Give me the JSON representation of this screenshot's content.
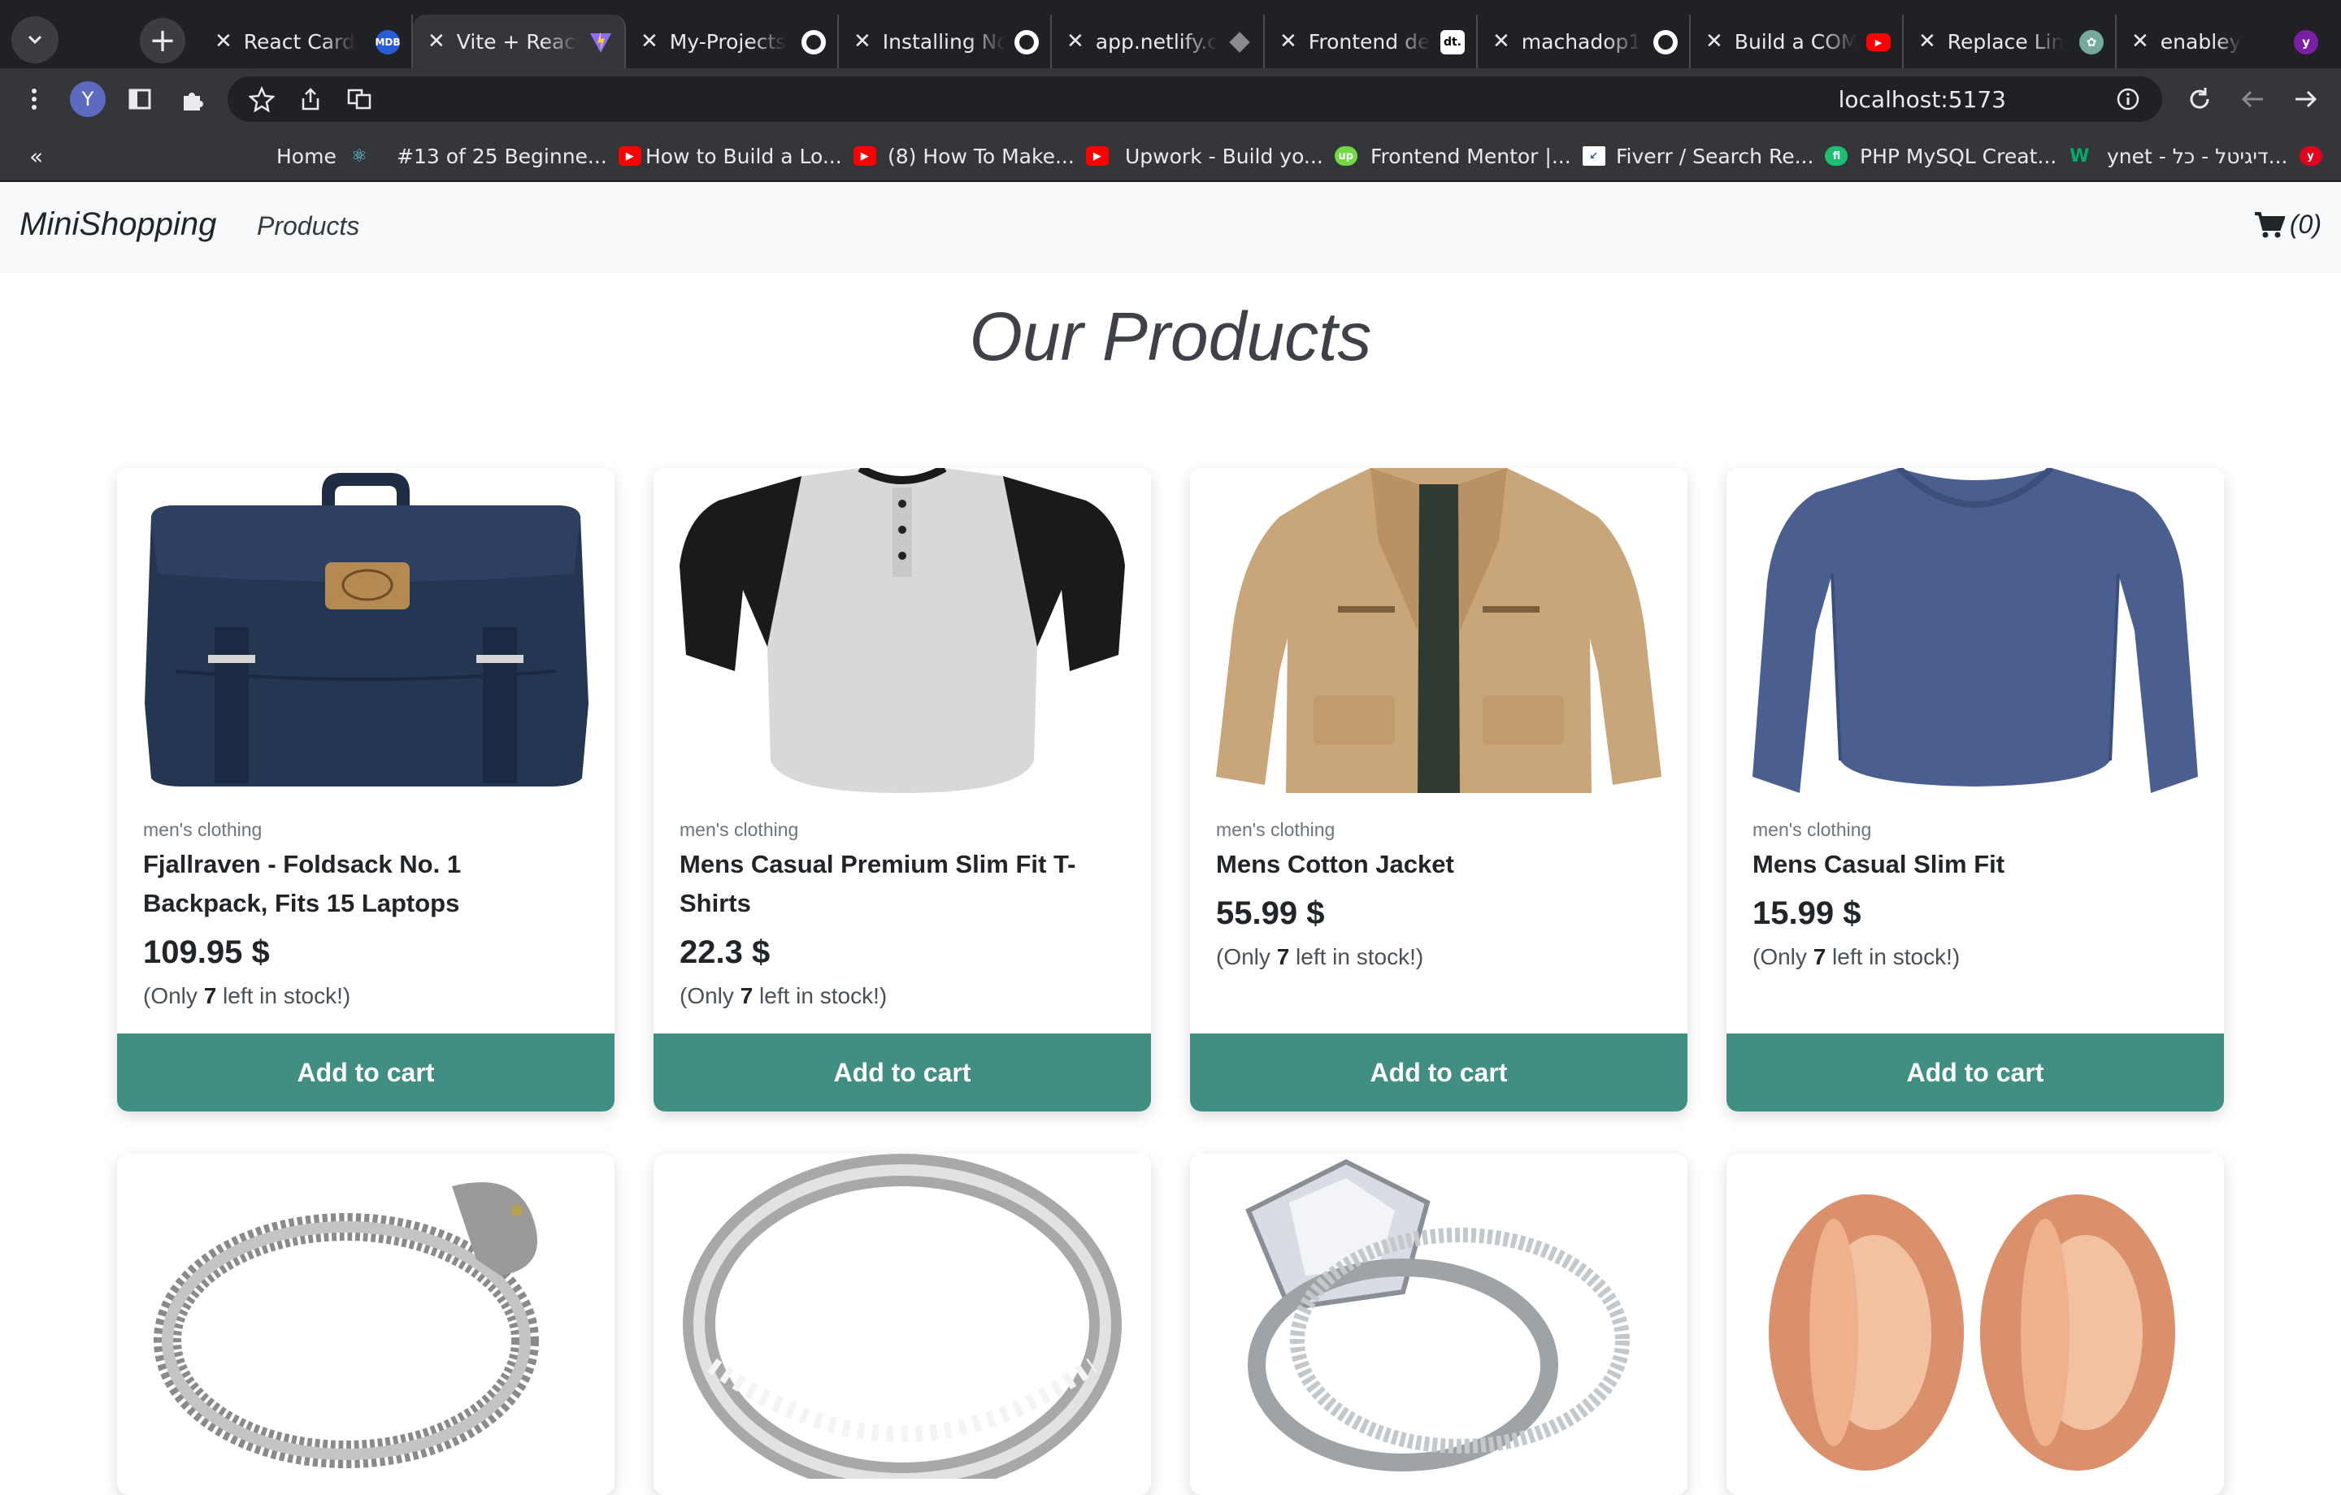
{
  "browser": {
    "tabs": [
      {
        "label": "React Card",
        "favicon": "mdb-icon",
        "active": false
      },
      {
        "label": "Vite + React",
        "favicon": "vite-icon",
        "active": true
      },
      {
        "label": "My-Projects",
        "favicon": "github-icon",
        "active": false
      },
      {
        "label": "Installing Node",
        "favicon": "github-icon",
        "active": false
      },
      {
        "label": "app.netlify.com",
        "favicon": "netlify-icon",
        "active": false
      },
      {
        "label": "Frontend dev",
        "favicon": "dt-icon",
        "active": false
      },
      {
        "label": "machadop1",
        "favicon": "github-icon",
        "active": false
      },
      {
        "label": "Build a COM",
        "favicon": "youtube-icon",
        "active": false
      },
      {
        "label": "Replace Lin",
        "favicon": "chatgpt-icon",
        "active": false
      },
      {
        "label": "enabley",
        "favicon": "yahoo-icon",
        "active": false
      }
    ],
    "new_tab": "+",
    "url": "localhost:5173",
    "profile_initial": "Y",
    "bookmarks_toggle": "«",
    "bookmarks": [
      {
        "label": "Home",
        "icon": "react-icon",
        "color": "#61dafb"
      },
      {
        "label": "#13 of 25 Beginne...",
        "icon": "youtube-icon",
        "color": "#ff0000"
      },
      {
        "label": "How to Build a Lo...",
        "icon": "youtube-icon",
        "color": "#ff0000"
      },
      {
        "label": "(8) How To Make...",
        "icon": "youtube-icon",
        "color": "#ff0000"
      },
      {
        "label": "Upwork - Build yo...",
        "icon": "upwork-icon",
        "color": "#6fda44"
      },
      {
        "label": "Frontend Mentor |...",
        "icon": "frontend-mentor-icon",
        "color": "#ffffff"
      },
      {
        "label": "Fiverr / Search Re...",
        "icon": "fiverr-icon",
        "color": "#1dbf73"
      },
      {
        "label": "PHP MySQL Creat...",
        "icon": "w-icon",
        "color": "#04aa6d"
      },
      {
        "label": "ynet - דיגיטל - כל...",
        "icon": "ynet-icon",
        "color": "#e2001a"
      }
    ]
  },
  "nav": {
    "brand": "MiniShopping",
    "link": "Products",
    "cart_count": "(0)"
  },
  "page": {
    "title": "Our Products"
  },
  "products": [
    {
      "category": "men's clothing",
      "title": "Fjallraven - Foldsack No. 1 Backpack, Fits 15 Laptops",
      "price": "109.95 $",
      "stock_prefix": "(Only ",
      "stock_count": "7",
      "stock_suffix": " left in stock!)",
      "button": "Add to cart",
      "image": "backpack-image"
    },
    {
      "category": "men's clothing",
      "title": "Mens Casual Premium Slim Fit T-Shirts",
      "price": "22.3 $",
      "stock_prefix": "(Only ",
      "stock_count": "7",
      "stock_suffix": " left in stock!)",
      "button": "Add to cart",
      "image": "tshirt-image"
    },
    {
      "category": "men's clothing",
      "title": "Mens Cotton Jacket",
      "price": "55.99 $",
      "stock_prefix": "(Only ",
      "stock_count": "7",
      "stock_suffix": " left in stock!)",
      "button": "Add to cart",
      "image": "jacket-image"
    },
    {
      "category": "men's clothing",
      "title": "Mens Casual Slim Fit",
      "price": "15.99 $",
      "stock_prefix": "(Only ",
      "stock_count": "7",
      "stock_suffix": " left in stock!)",
      "button": "Add to cart",
      "image": "long-sleeve-shirt-image"
    },
    {
      "image": "dragon-bracelet-image"
    },
    {
      "image": "silver-ring-image"
    },
    {
      "image": "diamond-ring-set-image"
    },
    {
      "image": "rose-gold-plugs-image"
    }
  ]
}
